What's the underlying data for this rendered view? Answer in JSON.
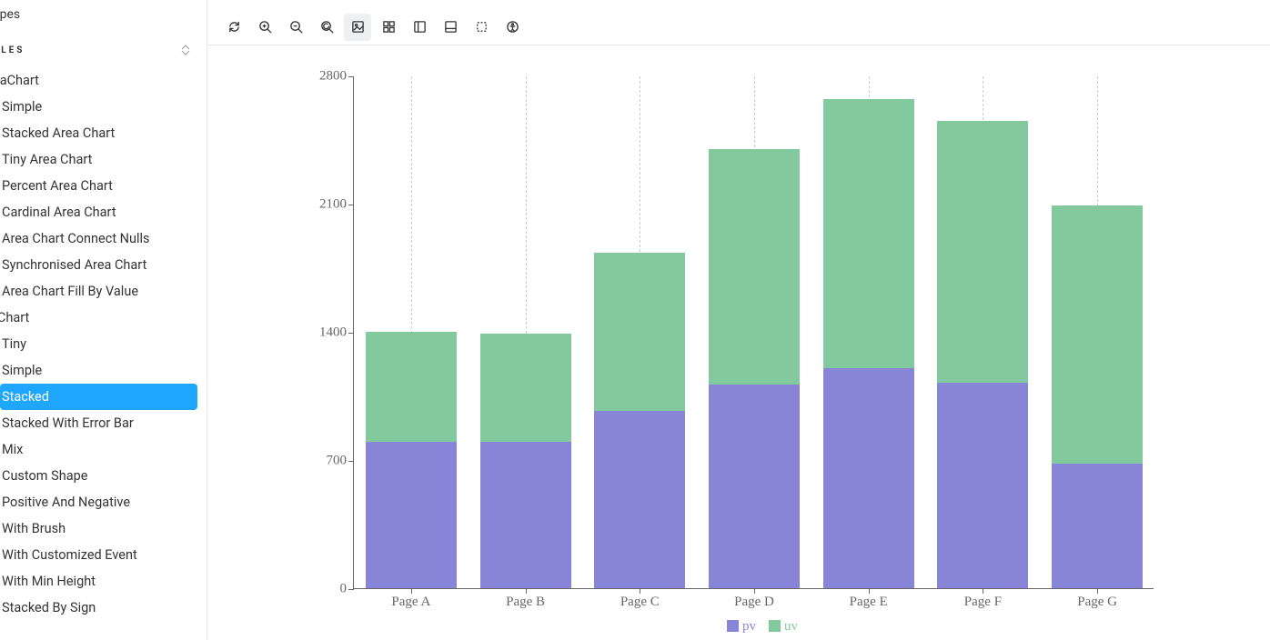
{
  "sidebar": {
    "truncated_title": "apes",
    "heading": "MPLES",
    "groups": [
      {
        "title": "eaChart",
        "items": [
          "Simple",
          "Stacked Area Chart",
          "Tiny Area Chart",
          "Percent Area Chart",
          "Cardinal Area Chart",
          "Area Chart Connect Nulls",
          "Synchronised Area Chart",
          "Area Chart Fill By Value"
        ]
      },
      {
        "title": "rChart",
        "items": [
          "Tiny",
          "Simple",
          "Stacked",
          "Stacked With Error Bar",
          "Mix",
          "Custom Shape",
          "Positive And Negative",
          "With Brush",
          "With Customized Event",
          "With Min Height",
          "Stacked By Sign"
        ],
        "selected_index": 2
      }
    ]
  },
  "toolbar": {
    "icons": [
      "sync",
      "zoom-in",
      "zoom-out",
      "zoom-reset",
      "image",
      "grid",
      "side-panel",
      "bottom-panel",
      "measure",
      "accessibility"
    ],
    "active_index": 4
  },
  "chart_data": {
    "type": "bar",
    "stacked": true,
    "categories": [
      "Page A",
      "Page B",
      "Page C",
      "Page D",
      "Page E",
      "Page F",
      "Page G"
    ],
    "series": [
      {
        "name": "pv",
        "color": "#8884d8",
        "values": [
          800,
          800,
          970,
          1110,
          1200,
          1120,
          680
        ]
      },
      {
        "name": "uv",
        "color": "#82ca9d",
        "values": [
          600,
          590,
          860,
          1290,
          1470,
          1430,
          1410
        ]
      }
    ],
    "ylim": [
      0,
      2800
    ],
    "yticks": [
      0,
      700,
      1400,
      2100,
      2800
    ],
    "legend": [
      "pv",
      "uv"
    ]
  }
}
